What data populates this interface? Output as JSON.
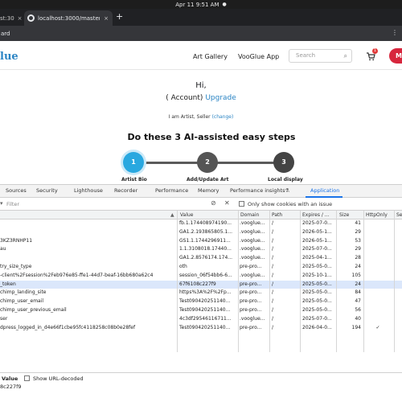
{
  "os_bar": {
    "time": "Apr 11  9:51 AM"
  },
  "browser": {
    "inactive_tab_label": "st:30",
    "active_tab_title": "localhost:3000/master-c",
    "new_tab_symbol": "+",
    "address_fragment": "ard",
    "menu_glyph": "⋮"
  },
  "site": {
    "logo_text": "lue",
    "nav": [
      "Art Gallery",
      "VooGlue App"
    ],
    "search_placeholder": "Search",
    "cart_count": "1",
    "user_initial": "M"
  },
  "hero": {
    "greeting": "Hi,",
    "account": "( Account)",
    "upgrade": "Upgrade",
    "role_text": "I am Artist, Seller",
    "change": "(change)",
    "steps_title": "Do these 3 AI-assisted easy steps",
    "steps": [
      {
        "number": "1",
        "label": "Artist Bio"
      },
      {
        "number": "2",
        "label": "Add/Update Art"
      },
      {
        "number": "3",
        "label": "Local display"
      }
    ]
  },
  "devtools": {
    "tabs": [
      "Sources",
      "Security",
      "Lighthouse",
      "Recorder",
      "Performance",
      "Memory",
      "Performance insights",
      "Application"
    ],
    "active_tab": "Application",
    "filter_placeholder": "Filter",
    "only_issue_label": "Only show cookies with an issue",
    "columns": [
      "Value",
      "Domain",
      "Path",
      "Expires / ...",
      "Size",
      "HttpOnly",
      "Se"
    ],
    "rows": [
      {
        "name": "",
        "value": "fb.1.174408974190...",
        "domain": ".vooglue...",
        "path": "/",
        "expires": "2025-07-0...",
        "size": "41",
        "httponly": ""
      },
      {
        "name": "",
        "value": "GA1.2.193865805.1...",
        "domain": ".vooglue...",
        "path": "/",
        "expires": "2026-05-1...",
        "size": "29",
        "httponly": ""
      },
      {
        "name": "3KZ3RNHP11",
        "value": "GS1.1.1744296911...",
        "domain": ".vooglue...",
        "path": "/",
        "expires": "2026-05-1...",
        "size": "53",
        "httponly": ""
      },
      {
        "name": "au",
        "value": "1.1.3108018.17440...",
        "domain": ".vooglue...",
        "path": "/",
        "expires": "2025-07-0...",
        "size": "29",
        "httponly": ""
      },
      {
        "name": "",
        "value": "GA1.2.8576174.174...",
        "domain": ".vooglue...",
        "path": "/",
        "expires": "2025-04-1...",
        "size": "28",
        "httponly": ""
      },
      {
        "name": "try_size_type",
        "value": "oth",
        "domain": "pre-pro...",
        "path": "/",
        "expires": "2025-05-0...",
        "size": "24",
        "httponly": ""
      },
      {
        "name": "-client%2Fsession%2Feb976e85-ffe1-44d7-beaf-16bb680a62c4",
        "value": "session_06f54bb6-6...",
        "domain": ".vooglue...",
        "path": "/",
        "expires": "2025-10-1...",
        "size": "105",
        "httponly": ""
      },
      {
        "name": "_token",
        "value": "67f6108c227f9",
        "domain": "pre-pro...",
        "path": "/",
        "expires": "2025-05-0...",
        "size": "24",
        "httponly": "",
        "selected": true
      },
      {
        "name": "chimp_landing_site",
        "value": "https%3A%2F%2Fp...",
        "domain": "pre-pro...",
        "path": "/",
        "expires": "2025-05-0...",
        "size": "84",
        "httponly": ""
      },
      {
        "name": "chimp_user_email",
        "value": "Test090420251140...",
        "domain": "pre-pro...",
        "path": "/",
        "expires": "2025-05-0...",
        "size": "47",
        "httponly": ""
      },
      {
        "name": "chimp_user_previous_email",
        "value": "Test090420251140...",
        "domain": "pre-pro...",
        "path": "/",
        "expires": "2025-05-0...",
        "size": "56",
        "httponly": ""
      },
      {
        "name": "ser",
        "value": "4c3df29546116711...",
        "domain": ".vooglue...",
        "path": "/",
        "expires": "2025-07-0...",
        "size": "40",
        "httponly": ""
      },
      {
        "name": "dpress_logged_in_d4e66f1cbe95fc4118258c08b0e28fef",
        "value": "Test090420251140...",
        "domain": "pre-pro...",
        "path": "/",
        "expires": "2026-04-0...",
        "size": "194",
        "httponly": "✓"
      }
    ],
    "value_panel": {
      "title": "Value",
      "show_url_decoded": "Show URL-decoded",
      "value": "8c227f9"
    }
  }
}
